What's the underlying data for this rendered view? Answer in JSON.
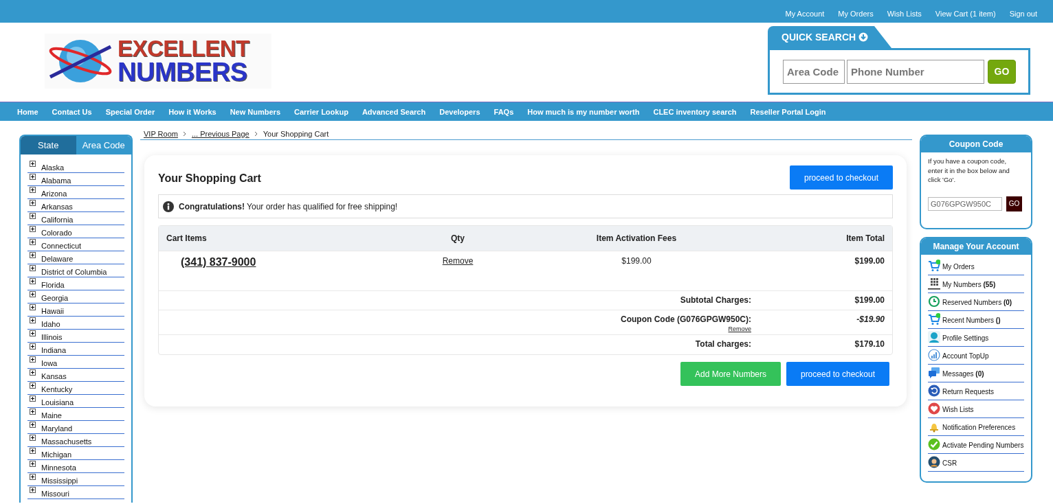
{
  "top_links": [
    "My Account",
    "My Orders",
    "Wish Lists",
    "View Cart (1 item)",
    "Sign out"
  ],
  "logo": {
    "line_1": "EXCELLENT",
    "line_2": "NUMBERS"
  },
  "quick_search": {
    "title": "QUICK SEARCH",
    "area_code_placeholder": "Area Code",
    "phone_placeholder": "Phone Number",
    "button": "GO"
  },
  "nav": [
    "Home",
    "Contact Us",
    "Special Order",
    "How it Works",
    "New Numbers",
    "Carrier Lookup",
    "Advanced Search",
    "Developers",
    "FAQs",
    "How much is my number worth",
    "CLEC inventory search",
    "Reseller Portal Login"
  ],
  "state_panel": {
    "tabs": [
      {
        "label": "State",
        "selected": true
      },
      {
        "label": "Area Code",
        "selected": false
      }
    ],
    "states": [
      "Alaska",
      "Alabama",
      "Arizona",
      "Arkansas",
      "California",
      "Colorado",
      "Connecticut",
      "Delaware",
      "District of Columbia",
      "Florida",
      "Georgia",
      "Hawaii",
      "Idaho",
      "Illinois",
      "Indiana",
      "Iowa",
      "Kansas",
      "Kentucky",
      "Louisiana",
      "Maine",
      "Maryland",
      "Massachusetts",
      "Michigan",
      "Minnesota",
      "Mississippi",
      "Missouri"
    ]
  },
  "breadcrumb": [
    {
      "label": "VIP Room",
      "link": true
    },
    {
      "label": "... Previous Page",
      "link": true
    },
    {
      "label": "Your Shopping Cart",
      "link": false
    }
  ],
  "cart": {
    "title": "Your Shopping Cart",
    "checkout_top": "proceed to checkout",
    "notice": "**Congratulations!** Your order has qualified for free shipping!",
    "columns": [
      "Cart Items",
      "Qty",
      "Item Activation Fees",
      "Item Total"
    ],
    "items": [
      {
        "number": "(341) 837-9000",
        "action": "Remove",
        "fee": "$199.00",
        "total": "$199.00"
      }
    ],
    "summary": [
      {
        "label": "Subtotal Charges:",
        "value": "$199.00",
        "kind": "plain"
      },
      {
        "label": "Coupon Code (G076GPGW950C):",
        "value": "-$19.90",
        "action": "Remove",
        "kind": "discount"
      },
      {
        "label": "Total charges:",
        "value": "$179.10",
        "kind": "plain"
      }
    ],
    "buttons": [
      {
        "label": "Add More Numbers",
        "kind": "secondary"
      },
      {
        "label": "proceed to checkout",
        "kind": "primary"
      }
    ]
  },
  "coupon_panel": {
    "title": "Coupon Code",
    "description": "If you have a coupon code, enter it in the box below and click 'Go'.",
    "value": "G076GPGW950C",
    "button": "GO"
  },
  "account_panel": {
    "title": "Manage Your Account",
    "items": [
      "My Orders",
      "My Numbers  **(55)**",
      "Reserved Numbers  **(0)**",
      "Recent Numbers  **()**",
      "Profile Settings",
      "Account TopUp",
      "Messages  **(0)**",
      "Return Requests",
      "Wish Lists",
      "Notification Preferences",
      "Activate Pending Numbers",
      "CSR"
    ]
  }
}
